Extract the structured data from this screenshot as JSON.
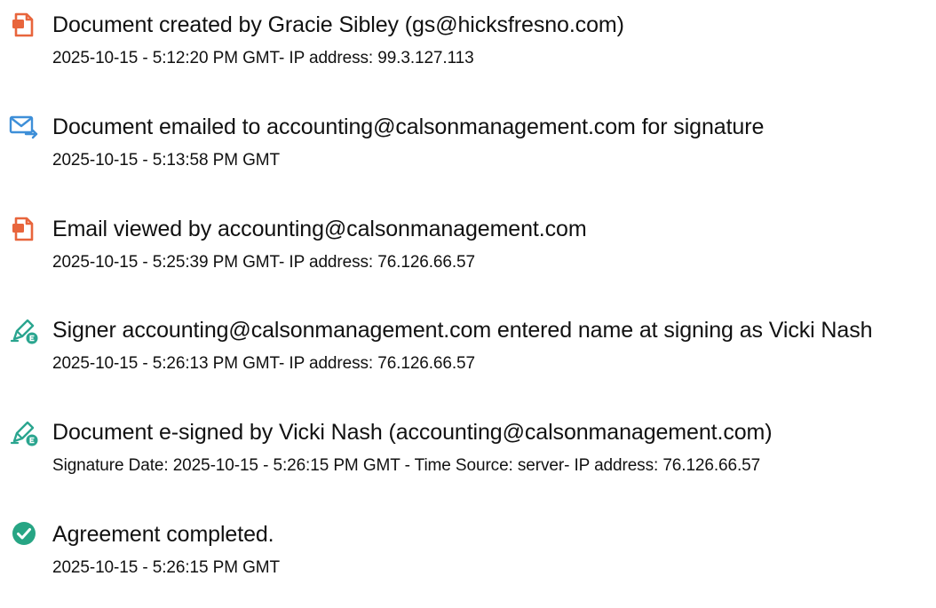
{
  "colors": {
    "document_icon": "#e8653c",
    "email_icon": "#3e8fd8",
    "sign_icon": "#2aa58f",
    "complete_icon": "#27a584",
    "text": "#111111"
  },
  "events": [
    {
      "icon": "document-created-icon",
      "title": "Document created by Gracie Sibley (gs@hicksfresno.com)",
      "detail": "2025-10-15 - 5:12:20 PM GMT- IP address: 99.3.127.113"
    },
    {
      "icon": "email-sent-icon",
      "title": "Document emailed to accounting@calsonmanagement.com for signature",
      "detail": "2025-10-15 - 5:13:58 PM GMT"
    },
    {
      "icon": "document-viewed-icon",
      "title": "Email viewed by accounting@calsonmanagement.com",
      "detail": "2025-10-15 - 5:25:39 PM GMT- IP address: 76.126.66.57"
    },
    {
      "icon": "pen-signature-icon",
      "title": "Signer accounting@calsonmanagement.com entered name at signing as Vicki Nash",
      "detail": "2025-10-15 - 5:26:13 PM GMT- IP address: 76.126.66.57"
    },
    {
      "icon": "pen-signature-icon",
      "title": "Document e-signed by Vicki Nash (accounting@calsonmanagement.com)",
      "detail": "Signature Date: 2025-10-15 - 5:26:15 PM GMT - Time Source: server- IP address: 76.126.66.57"
    },
    {
      "icon": "checkmark-circle-icon",
      "title": "Agreement completed.",
      "detail": "2025-10-15 - 5:26:15 PM GMT"
    }
  ]
}
